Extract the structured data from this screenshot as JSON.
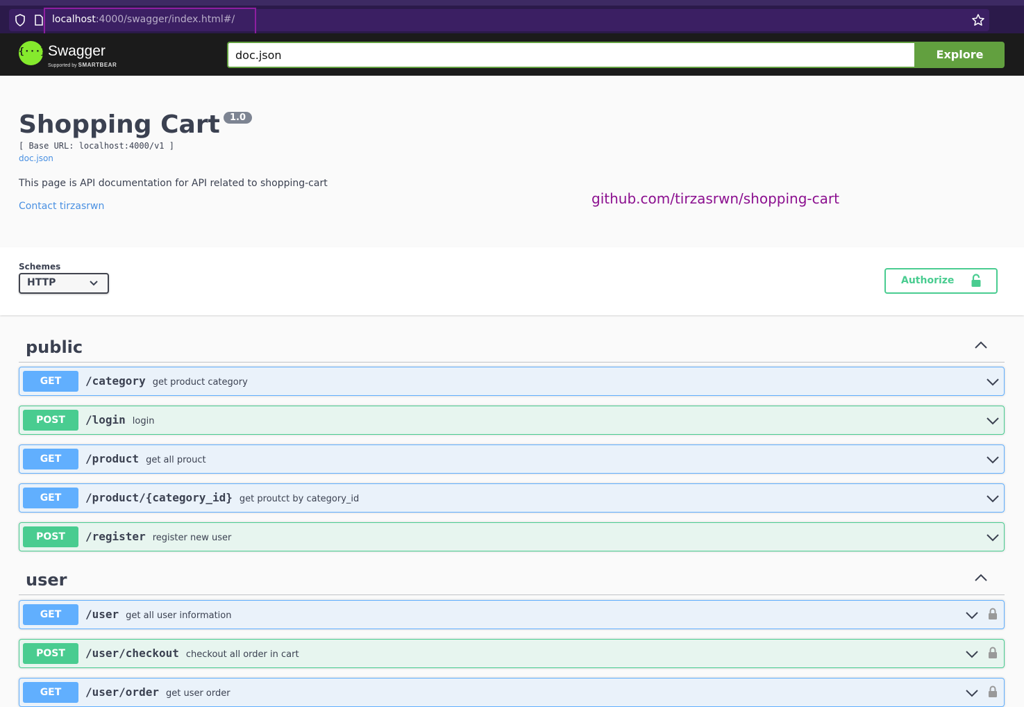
{
  "browser": {
    "url_host": "localhost",
    "url_rest": ":4000/swagger/index.html#/"
  },
  "topbar": {
    "logo_word": "Swagger",
    "logo_braces": "{···}",
    "logo_sub_prefix": "Supported by",
    "logo_sub_brand": "SMARTBEAR",
    "spec_url": "doc.json",
    "explore_label": "Explore"
  },
  "info": {
    "title": "Shopping Cart",
    "version": "1.0",
    "base_url": "[ Base URL: localhost:4000/v1 ]",
    "doc_link": "doc.json",
    "description": "This page is API documentation for API related to shopping-cart",
    "contact": "Contact tirzasrwn",
    "github": "github.com/tirzasrwn/shopping-cart"
  },
  "schemes": {
    "label": "Schemes",
    "selected": "HTTP",
    "authorize_label": "Authorize"
  },
  "tags": [
    {
      "name": "public",
      "operations": [
        {
          "method": "GET",
          "path": "/category",
          "summary": "get product category",
          "locked": false
        },
        {
          "method": "POST",
          "path": "/login",
          "summary": "login",
          "locked": false
        },
        {
          "method": "GET",
          "path": "/product",
          "summary": "get all prouct",
          "locked": false
        },
        {
          "method": "GET",
          "path": "/product/{category_id}",
          "summary": "get proutct by category_id",
          "locked": false
        },
        {
          "method": "POST",
          "path": "/register",
          "summary": "register new user",
          "locked": false
        }
      ]
    },
    {
      "name": "user",
      "operations": [
        {
          "method": "GET",
          "path": "/user",
          "summary": "get all user information",
          "locked": true
        },
        {
          "method": "POST",
          "path": "/user/checkout",
          "summary": "checkout all order in cart",
          "locked": true
        },
        {
          "method": "GET",
          "path": "/user/order",
          "summary": "get user order",
          "locked": true
        }
      ]
    }
  ],
  "colors": {
    "get": "#61affe",
    "post": "#49cc90",
    "explore": "#62a03f",
    "link": "#4990e2",
    "github": "#8b0f8f"
  }
}
